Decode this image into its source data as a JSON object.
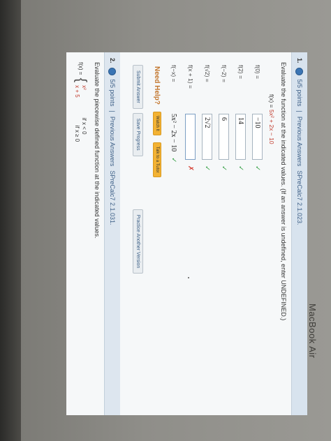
{
  "device": {
    "label": "MacBook Air"
  },
  "question1": {
    "number": "1.",
    "points": "5/5 points",
    "prev": "Previous Answers",
    "source": "SPreCalc7 2.1.023.",
    "prompt": "Evaluate the function at the indicated values. (If an answer is undefined, enter UNDEFINED.)",
    "function_prefix": "f(x) = ",
    "function_expr": "5x² + 2x − 10",
    "rows": [
      {
        "label": "f(0) =",
        "answer": "−10",
        "status": "✓"
      },
      {
        "label": "f(2) =",
        "answer": "14",
        "status": "✓"
      },
      {
        "label": "f(−2) =",
        "answer": "6",
        "status": "✓"
      },
      {
        "label": "f(√2) =",
        "answer": "2√2",
        "status": "✓"
      },
      {
        "label": "f(x + 1) =",
        "answer": "",
        "status": "✗"
      },
      {
        "label": "f(−x) =",
        "answer": "5x² − 2x − 10",
        "status": "✓"
      }
    ],
    "need_help": "Need Help?",
    "watch_it": "Watch It",
    "talk_to_tutor": "Talk to a Tutor",
    "submit": "Submit Answer",
    "save": "Save Progress",
    "practice": "Practice Another Version"
  },
  "question2": {
    "number": "2.",
    "points": "5/5 points",
    "prev": "Previous Answers",
    "source": "SPreCalc7 2.1.031.",
    "prompt": "Evaluate the piecewise defined function at the indicated values.",
    "f_label": "f(x) =",
    "case1_expr": "x²",
    "case1_cond": "if x < 0",
    "case2_expr": "x + 5",
    "case2_cond": "if x ≥ 0"
  }
}
